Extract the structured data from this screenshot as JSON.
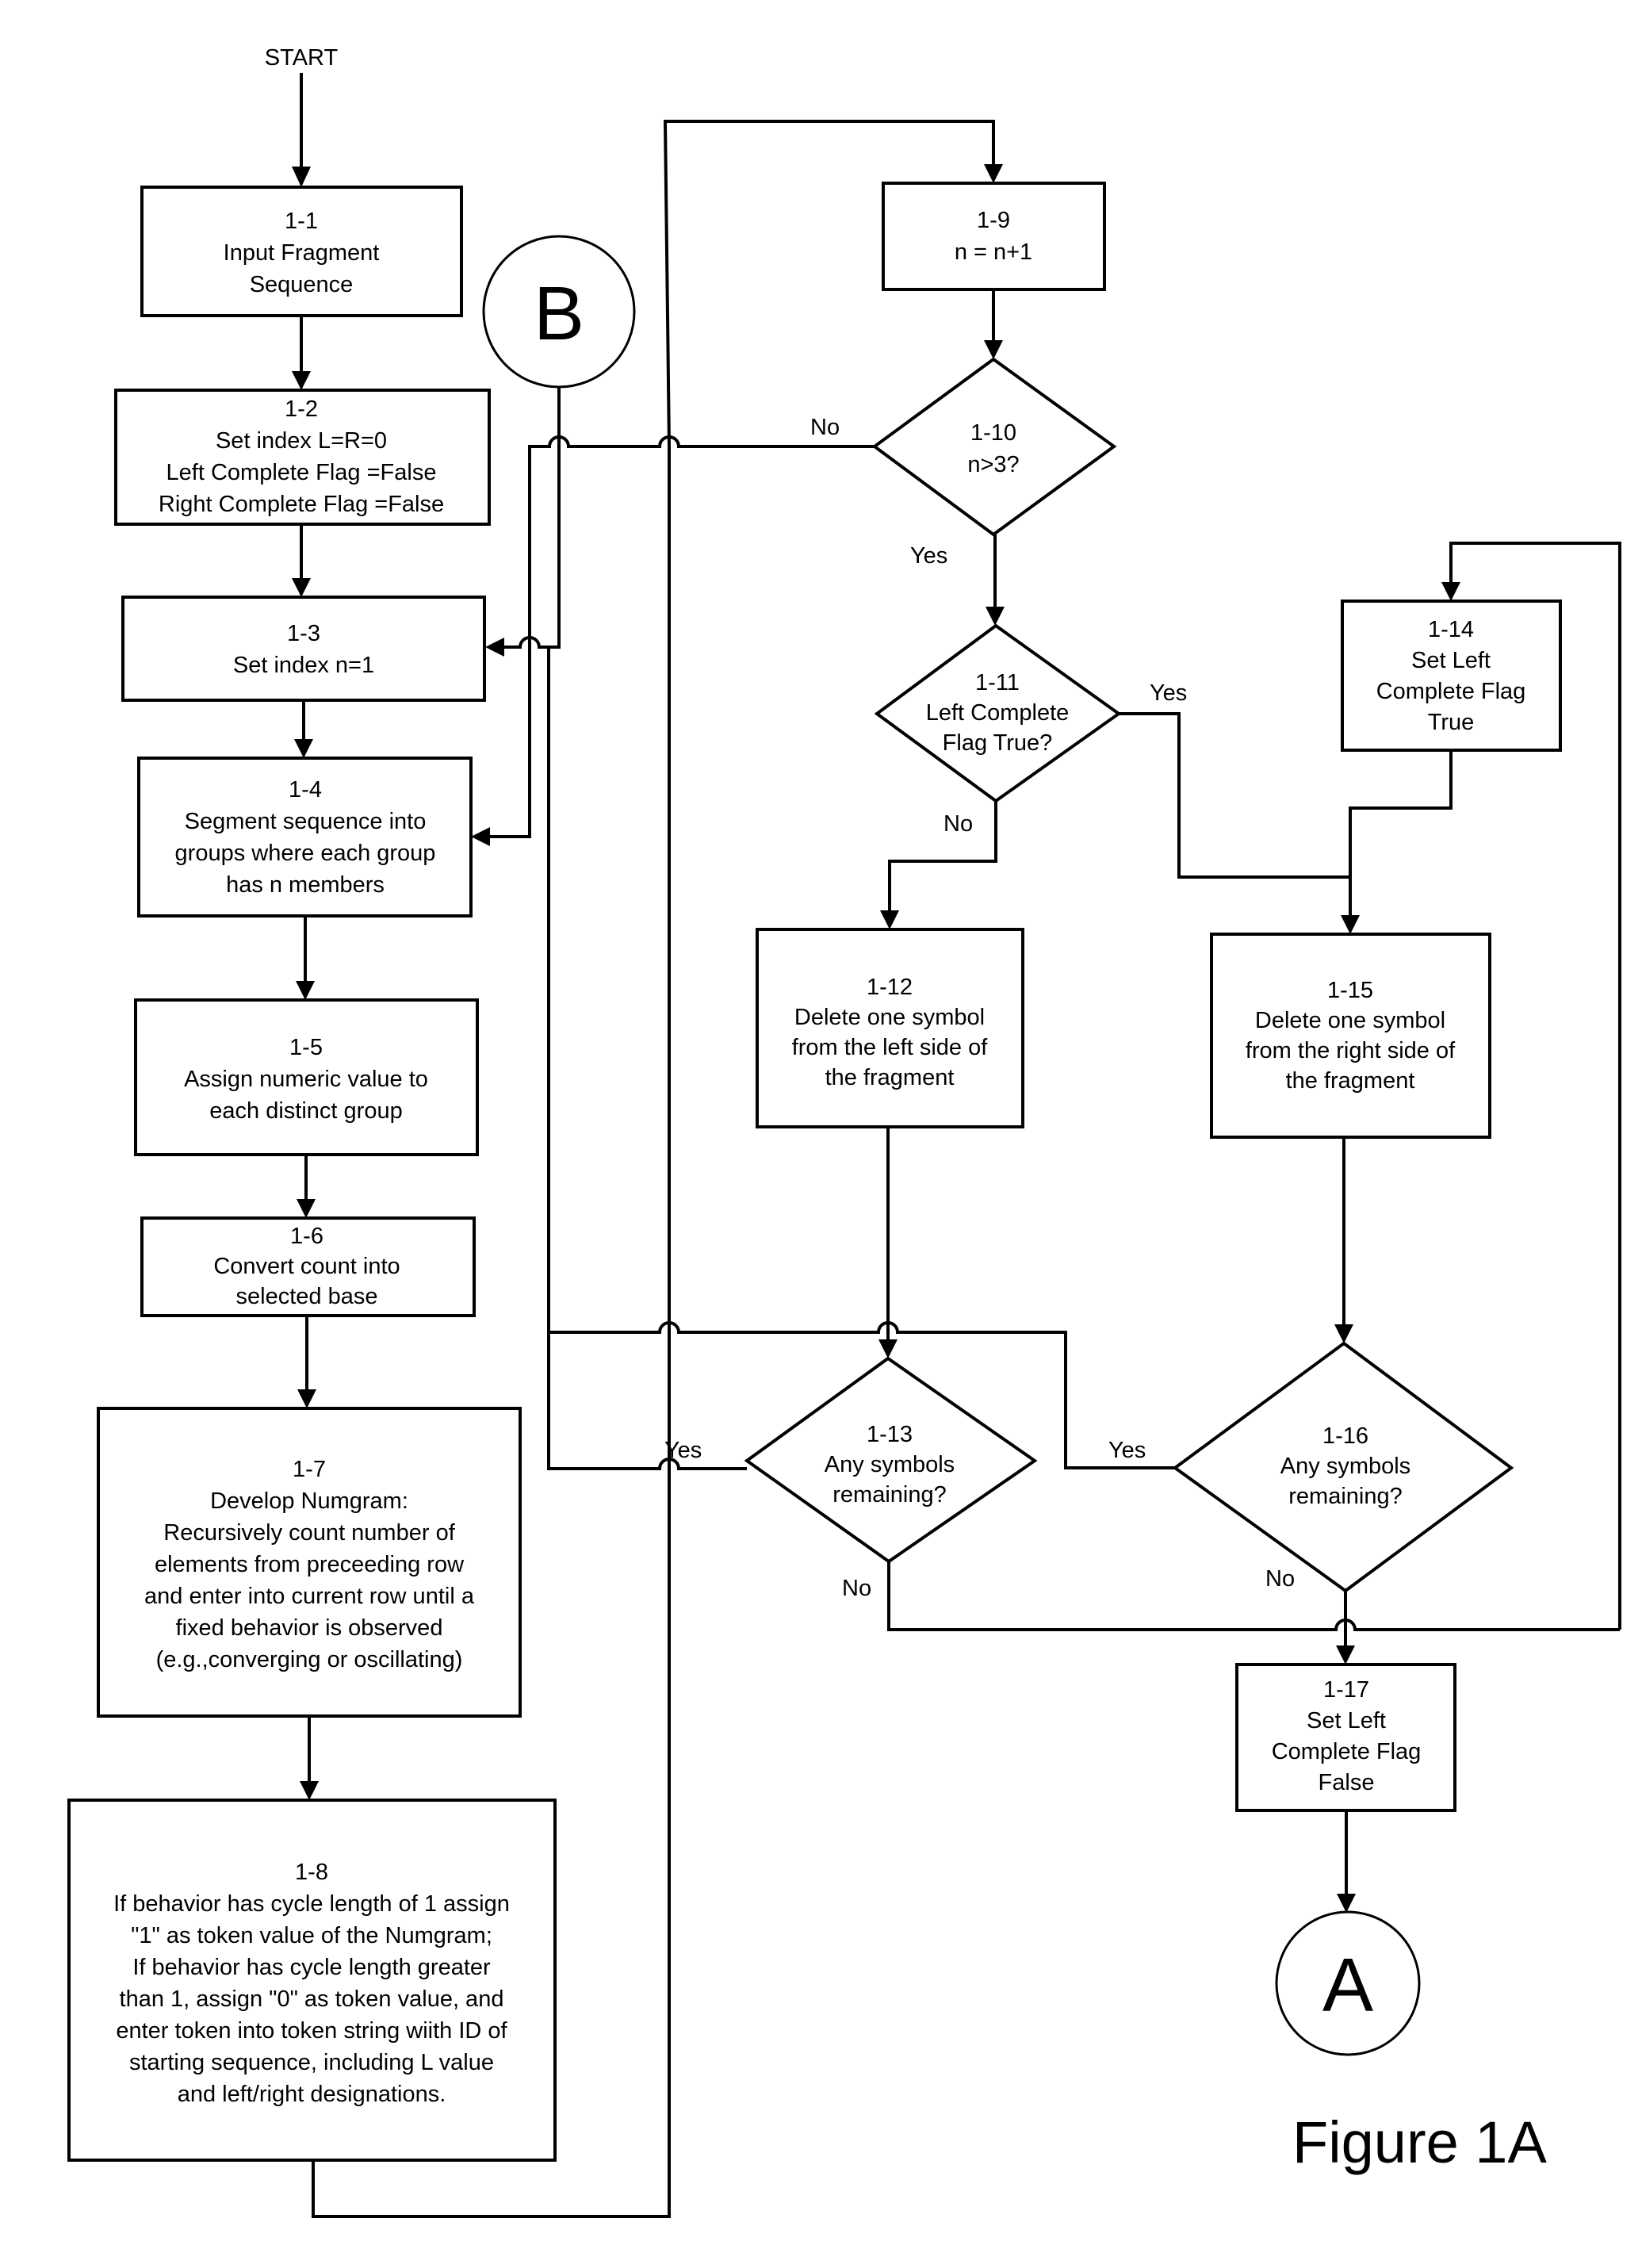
{
  "figure": {
    "title": "Figure 1A",
    "start_label": "START"
  },
  "connectors": {
    "a": "A",
    "b": "B"
  },
  "nodes": {
    "n1": {
      "id": "1-1",
      "lines": [
        "Input Fragment",
        "Sequence"
      ]
    },
    "n2": {
      "id": "1-2",
      "lines": [
        "Set index L=R=0",
        "Left Complete Flag =False",
        "Right Complete Flag =False"
      ]
    },
    "n3": {
      "id": "1-3",
      "lines": [
        "Set index n=1"
      ]
    },
    "n4": {
      "id": "1-4",
      "lines": [
        "Segment sequence into",
        "groups where each group",
        "has n members"
      ]
    },
    "n5": {
      "id": "1-5",
      "lines": [
        "Assign numeric value to",
        "each distinct group"
      ]
    },
    "n6": {
      "id": "1-6",
      "lines": [
        "Convert count into",
        "selected base"
      ]
    },
    "n7": {
      "id": "1-7",
      "lines": [
        "Develop Numgram:",
        "Recursively count number of",
        "elements from preceeding row",
        "and enter into current row until a",
        "fixed behavior is observed",
        "(e.g.,converging or oscillating)"
      ]
    },
    "n8": {
      "id": "1-8",
      "lines": [
        "If behavior has cycle length of 1 assign",
        "\"1\" as token value of the Numgram;",
        "If behavior has cycle length greater",
        "than 1, assign \"0\" as token value, and",
        "enter token into token string wiith ID of",
        "starting sequence, including L value",
        "and left/right designations."
      ]
    },
    "n9": {
      "id": "1-9",
      "lines": [
        "n = n+1"
      ]
    },
    "n10": {
      "id": "1-10",
      "lines": [
        "n>3?"
      ]
    },
    "n11": {
      "id": "1-11",
      "lines": [
        "Left Complete",
        "Flag True?"
      ]
    },
    "n12": {
      "id": "1-12",
      "lines": [
        "Delete one symbol",
        "from the left side of",
        "the fragment"
      ]
    },
    "n13": {
      "id": "1-13",
      "lines": [
        "Any symbols",
        "remaining?"
      ]
    },
    "n14": {
      "id": "1-14",
      "lines": [
        "Set Left",
        "Complete Flag",
        "True"
      ]
    },
    "n15": {
      "id": "1-15",
      "lines": [
        "Delete one symbol",
        "from the right  side of",
        "the fragment"
      ]
    },
    "n16": {
      "id": "1-16",
      "lines": [
        "Any symbols",
        "remaining?"
      ]
    },
    "n17": {
      "id": "1-17",
      "lines": [
        "Set Left",
        "Complete Flag",
        "False"
      ]
    }
  },
  "edge_labels": {
    "n10_no": "No",
    "n10_yes": "Yes",
    "n11_yes": "Yes",
    "n11_no": "No",
    "n13_yes": "Yes",
    "n13_no": "No",
    "n16_yes": "Yes",
    "n16_no": "No"
  }
}
